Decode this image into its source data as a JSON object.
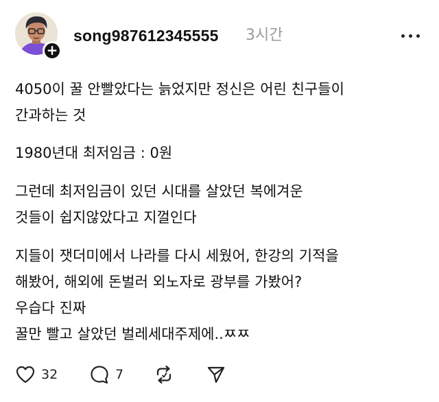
{
  "author": {
    "username": "song987612345555",
    "time": "3시간",
    "avatar_icon": "user-avatar-cartoon-icon",
    "follow_icon": "plus-icon"
  },
  "post": {
    "lines": [
      "4050이 꿀 안빨았다는 늙었지만 정신은 어린 친구들이",
      "간과하는 것",
      "1980년대 최저임금 : 0원",
      "그런데 최저임금이 있던 시대를 살았던 복에겨운",
      "것들이 쉽지않았다고 지껄인다",
      "지들이 잿더미에서 나라를 다시 세웠어, 한강의 기적을",
      "해봤어, 해외에 돈벌러 외노자로 광부를 가봤어?",
      "우습다 진짜",
      "꿀만 빨고 살았던 벌레세대주제에..ㅉㅉ"
    ]
  },
  "actions": {
    "like_count": "32",
    "comment_count": "7",
    "icons": [
      "heart-icon",
      "comment-icon",
      "repost-icon",
      "share-icon"
    ]
  },
  "colors": {
    "text": "#111111",
    "muted": "#9a9a9a",
    "badge": "#111111",
    "background": "#ffffff"
  }
}
